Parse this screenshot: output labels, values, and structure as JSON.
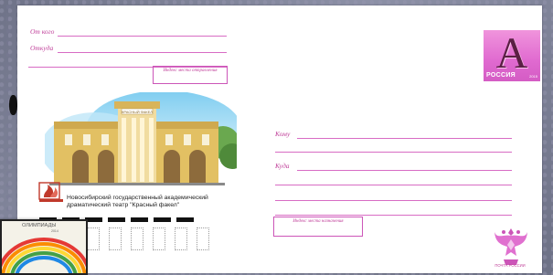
{
  "sender": {
    "from_label": "От кого",
    "from_where_label": "Откуда",
    "index_box_label": "Индекс места отправления"
  },
  "recipient": {
    "to_label": "Кому",
    "where_label": "Куда",
    "index_box_label": "Индекс места назначения"
  },
  "stamp": {
    "letter": "А",
    "country": "РОССИЯ",
    "year": "2015"
  },
  "illustration": {
    "building_sign": "КРАСНЫЙ ФАКЕЛ",
    "caption_line1": "Новосибирский государственный академический",
    "caption_line2": "драматический театр \"Красный факел\""
  },
  "postal_logo": {
    "caption": "ПОЧТА РОССИИ"
  },
  "overlay_card": {
    "title": "ОЛИМПИАДЫ",
    "year": "2014"
  },
  "colors": {
    "accent": "#d86cc4",
    "stamp": "#e06ad0",
    "label": "#c0409a"
  }
}
